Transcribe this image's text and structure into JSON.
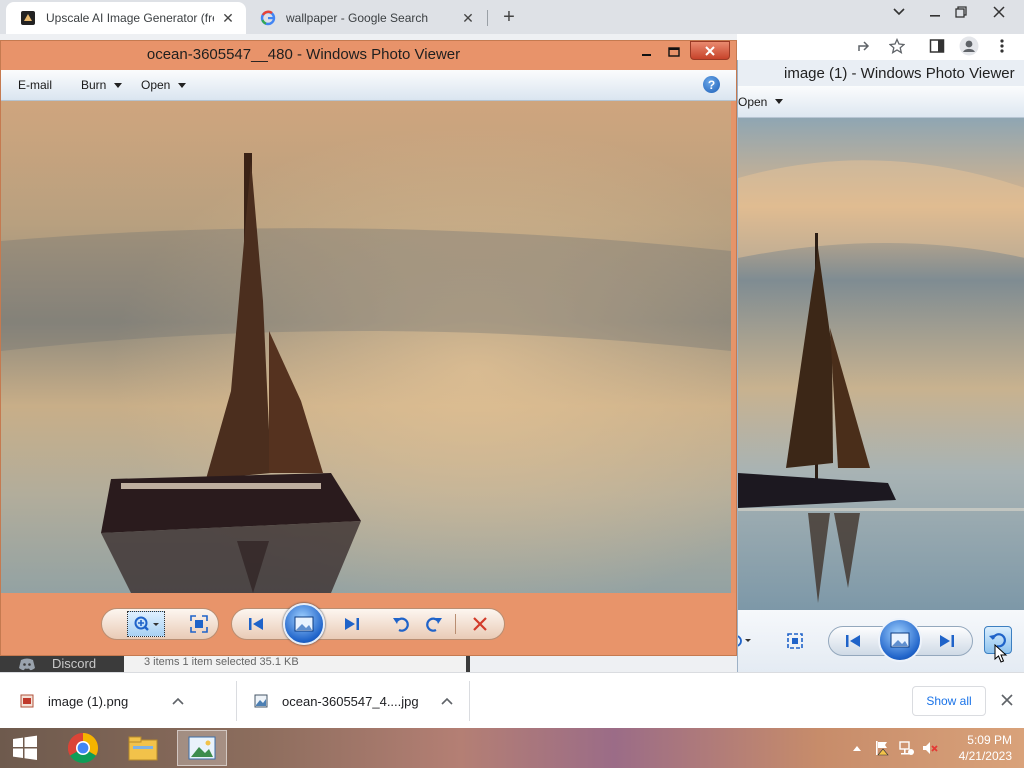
{
  "browser": {
    "tabs": [
      {
        "title": "Upscale AI Image Generator (free",
        "active": true
      },
      {
        "title": "wallpaper - Google Search",
        "active": false
      }
    ],
    "new_tab_icon": "plus-icon",
    "window_controls": [
      "chevron-down-icon",
      "minimize-icon",
      "restore-icon",
      "close-icon"
    ]
  },
  "viewer_back": {
    "title": "image (1) - Windows Photo Viewer",
    "open_label": "Open"
  },
  "viewer_front": {
    "title": "ocean-3605547__480 - Windows Photo Viewer",
    "menu": {
      "email": "E-mail",
      "burn": "Burn",
      "open": "Open"
    },
    "help_glyph": "?",
    "controls": [
      "zoom-icon",
      "actual-size-icon",
      "previous-icon",
      "slideshow-icon",
      "next-icon",
      "rotate-ccw-icon",
      "rotate-cw-icon",
      "delete-icon"
    ]
  },
  "explorer": {
    "discord_label": "Discord",
    "status_text": "3 items     1 item selected  35.1 KB"
  },
  "downloads": {
    "items": [
      {
        "name": "image (1).png",
        "icon": "png-file-icon"
      },
      {
        "name": "ocean-3605547_4....jpg",
        "icon": "jpg-file-icon"
      }
    ],
    "show_all": "Show all"
  },
  "taskbar": {
    "apps": [
      "start-icon",
      "chrome-icon",
      "file-explorer-icon",
      "photo-viewer-icon"
    ],
    "time": "5:09 PM",
    "date": "4/21/2023"
  },
  "colors": {
    "viewer_frame": "#e8936a",
    "accent_blue": "#1a73e8"
  }
}
